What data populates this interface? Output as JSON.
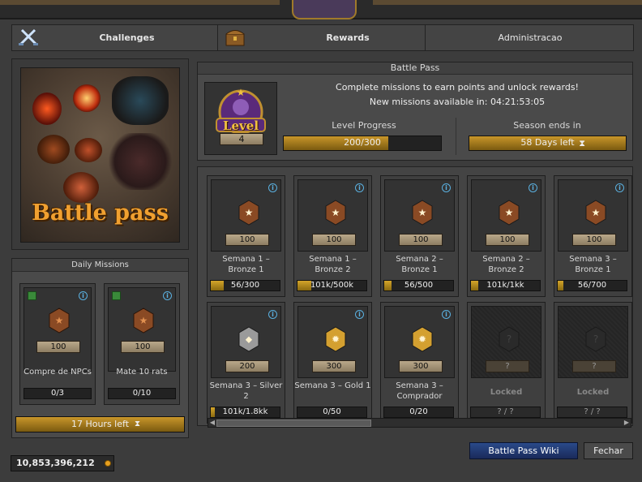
{
  "tabs": [
    {
      "label": "Challenges",
      "icon": "crossed-swords-icon"
    },
    {
      "label": "Rewards",
      "icon": "treasure-chest-icon"
    },
    {
      "label": "Administracao"
    }
  ],
  "artwork": {
    "title": "Battle pass"
  },
  "daily": {
    "title": "Daily Missions",
    "missions": [
      {
        "name": "Compre de NPCs",
        "points": "100",
        "progress": "0/3",
        "fraction": 0
      },
      {
        "name": "Mate 10 rats",
        "points": "100",
        "progress": "0/10",
        "fraction": 0
      }
    ],
    "timer": "17 Hours left"
  },
  "battlepass": {
    "title": "Battle Pass",
    "line1": "Complete missions to earn points and unlock rewards!",
    "line2": "New missions available in: 04:21:53:05",
    "level_label": "Level",
    "level": "4",
    "progress_label": "Level Progress",
    "progress": "200/300",
    "progress_fraction": 0.667,
    "season_label": "Season ends in",
    "season": "58 Days left"
  },
  "weekly": [
    {
      "name": "Semana 1 – Bronze 1",
      "points": "100",
      "progress": "56/300",
      "fraction": 0.19,
      "tier": "bronze"
    },
    {
      "name": "Semana 1 – Bronze 2",
      "points": "100",
      "progress": "101k/500k",
      "fraction": 0.2,
      "tier": "bronze"
    },
    {
      "name": "Semana 2 – Bronze 1",
      "points": "100",
      "progress": "56/500",
      "fraction": 0.11,
      "tier": "bronze"
    },
    {
      "name": "Semana 2 – Bronze 2",
      "points": "100",
      "progress": "101k/1kk",
      "fraction": 0.1,
      "tier": "bronze"
    },
    {
      "name": "Semana 3 – Bronze 1",
      "points": "100",
      "progress": "56/700",
      "fraction": 0.08,
      "tier": "bronze"
    },
    {
      "name": "Semana 3 – Silver 2",
      "points": "200",
      "progress": "101k/1.8kk",
      "fraction": 0.06,
      "tier": "silver"
    },
    {
      "name": "Semana 3 – Gold 1",
      "points": "300",
      "progress": "0/50",
      "fraction": 0,
      "tier": "gold"
    },
    {
      "name": "Semana 3 – Comprador",
      "points": "300",
      "progress": "0/20",
      "fraction": 0,
      "tier": "gold"
    },
    {
      "name": "Locked",
      "points": "?",
      "progress": "? / ?",
      "fraction": 0,
      "tier": "locked"
    },
    {
      "name": "Locked",
      "points": "?",
      "progress": "? / ?",
      "fraction": 0,
      "tier": "locked"
    }
  ],
  "buttons": {
    "wiki": "Battle Pass Wiki",
    "close": "Fechar"
  },
  "gold": "10,853,396,212",
  "colors": {
    "accent": "#c9962a",
    "info": "#5ab0e0",
    "bronze": "#8a4a24",
    "silver": "#9a9a9a",
    "gold": "#d4a030"
  }
}
